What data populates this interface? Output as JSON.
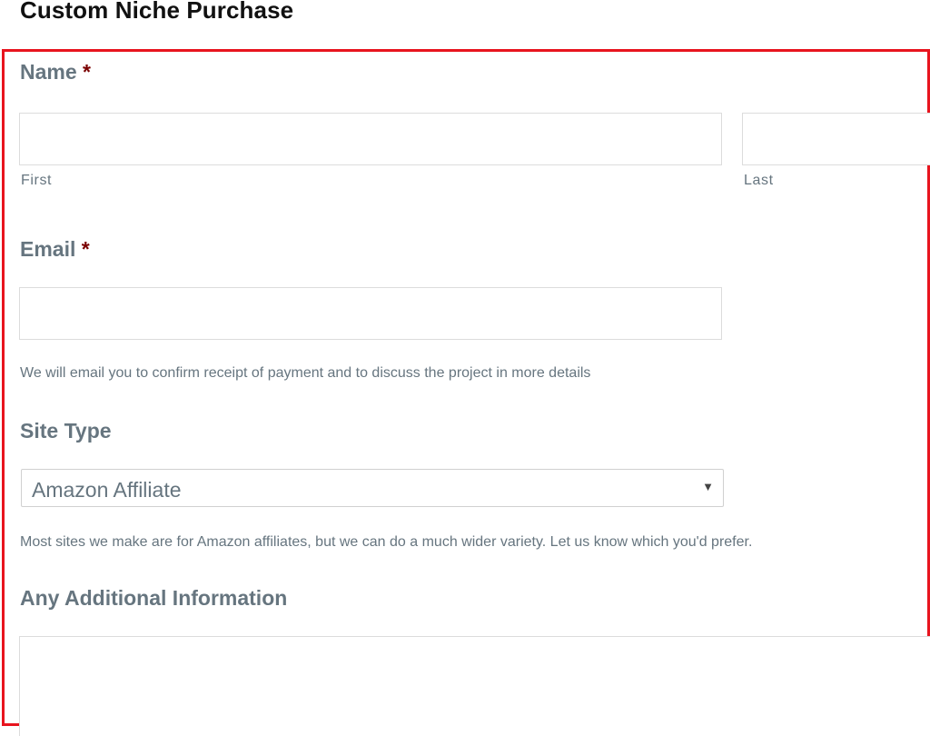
{
  "page": {
    "title": "Custom Niche Purchase"
  },
  "form": {
    "name": {
      "label": "Name",
      "required_mark": "*",
      "first_sublabel": "First",
      "last_sublabel": "Last",
      "first_value": "",
      "last_value": ""
    },
    "email": {
      "label": "Email",
      "required_mark": "*",
      "value": "",
      "help": "We will email you to confirm receipt of payment and to discuss the project in more details"
    },
    "site_type": {
      "label": "Site Type",
      "selected": "Amazon Affiliate",
      "arrow_icon": "triangle-down",
      "help": "Most sites we make are for Amazon affiliates, but we can do a much wider variety. Let us know which you'd prefer."
    },
    "additional_info": {
      "label": "Any Additional Information",
      "value": ""
    }
  },
  "colors": {
    "highlight_border": "#e8141e",
    "label_text": "#66757f",
    "required_mark": "#7a0000",
    "input_border": "#dcdcdc"
  }
}
